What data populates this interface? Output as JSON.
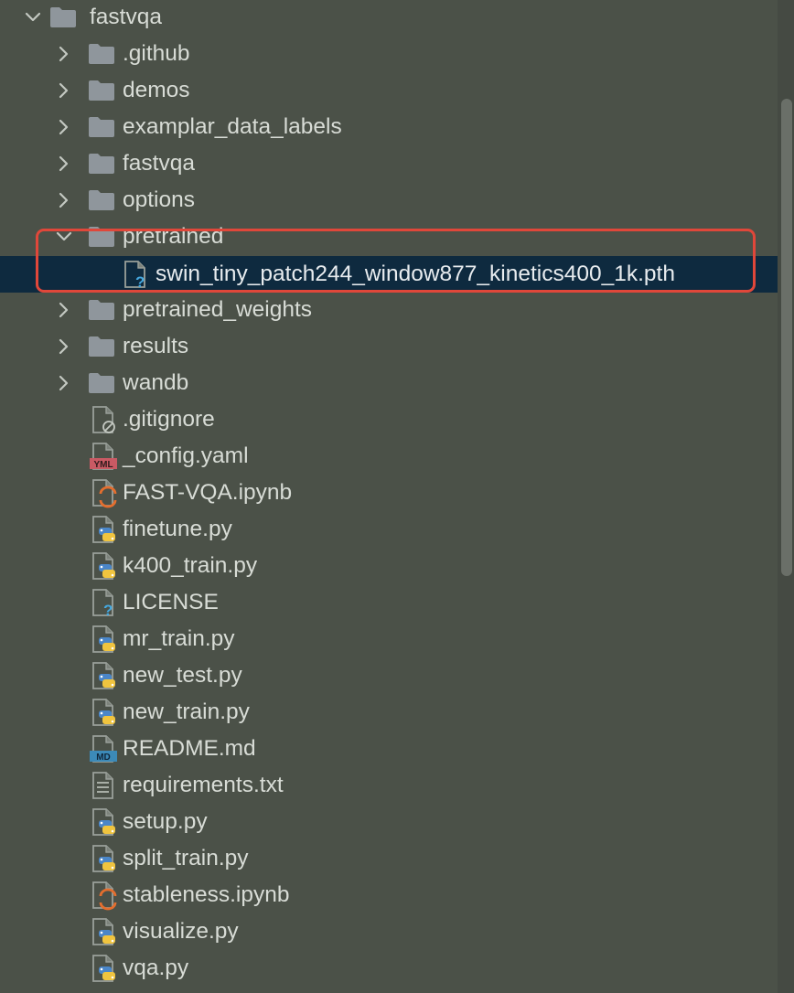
{
  "tree": {
    "root": {
      "label": "fastvqa",
      "expanded": true
    },
    "items": [
      {
        "label": ".github",
        "type": "folder",
        "expanded": false
      },
      {
        "label": "demos",
        "type": "folder",
        "expanded": false
      },
      {
        "label": "examplar_data_labels",
        "type": "folder",
        "expanded": false
      },
      {
        "label": "fastvqa",
        "type": "folder",
        "expanded": false
      },
      {
        "label": "options",
        "type": "folder",
        "expanded": false
      },
      {
        "label": "pretrained",
        "type": "folder",
        "expanded": true
      },
      {
        "label": "swin_tiny_patch244_window877_kinetics400_1k.pth",
        "type": "file",
        "icon": "unknown-file-icon",
        "selected": true
      },
      {
        "label": "pretrained_weights",
        "type": "folder",
        "expanded": false
      },
      {
        "label": "results",
        "type": "folder",
        "expanded": false
      },
      {
        "label": "wandb",
        "type": "folder",
        "expanded": false
      },
      {
        "label": ".gitignore",
        "type": "file",
        "icon": "gitignore-file-icon"
      },
      {
        "label": "_config.yaml",
        "type": "file",
        "icon": "yaml-file-icon",
        "badge": "YML"
      },
      {
        "label": "FAST-VQA.ipynb",
        "type": "file",
        "icon": "jupyter-file-icon"
      },
      {
        "label": "finetune.py",
        "type": "file",
        "icon": "python-file-icon"
      },
      {
        "label": "k400_train.py",
        "type": "file",
        "icon": "python-file-icon"
      },
      {
        "label": "LICENSE",
        "type": "file",
        "icon": "unknown-file-icon"
      },
      {
        "label": "mr_train.py",
        "type": "file",
        "icon": "python-file-icon"
      },
      {
        "label": "new_test.py",
        "type": "file",
        "icon": "python-file-icon"
      },
      {
        "label": "new_train.py",
        "type": "file",
        "icon": "python-file-icon"
      },
      {
        "label": "README.md",
        "type": "file",
        "icon": "markdown-file-icon",
        "badge": "MD"
      },
      {
        "label": "requirements.txt",
        "type": "file",
        "icon": "text-file-icon"
      },
      {
        "label": "setup.py",
        "type": "file",
        "icon": "python-file-icon"
      },
      {
        "label": "split_train.py",
        "type": "file",
        "icon": "python-file-icon"
      },
      {
        "label": "stableness.ipynb",
        "type": "file",
        "icon": "jupyter-file-icon"
      },
      {
        "label": "visualize.py",
        "type": "file",
        "icon": "python-file-icon"
      },
      {
        "label": "vqa.py",
        "type": "file",
        "icon": "python-file-icon"
      }
    ]
  },
  "colors": {
    "background": "#4b5148",
    "selection": "#0e2a3f",
    "highlight_box": "#e0473a",
    "folder": "#8f969c",
    "python_blue": "#4a86c8",
    "python_yellow": "#f0c43f",
    "jupyter_orange": "#e46e2e",
    "yaml_badge": "#c95a64",
    "markdown_badge": "#3c8ab8"
  }
}
